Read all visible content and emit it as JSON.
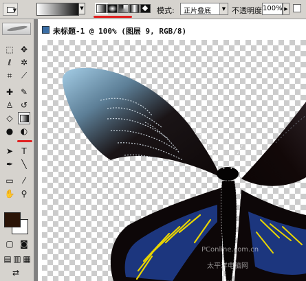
{
  "options_bar": {
    "mode_label": "模式:",
    "mode_value": "正片叠底",
    "opacity_label": "不透明度:",
    "opacity_value": "100%",
    "gradient_types": [
      "linear",
      "radial",
      "angle",
      "reflected",
      "diamond"
    ]
  },
  "document": {
    "title": "未标题-1 @ 100% (图层 9, RGB/8)"
  },
  "toolbox": {
    "active_tool": "gradient-tool",
    "foreground_color": "#2b1508",
    "background_color": "#ffffff"
  },
  "watermark": {
    "line1": "PConline.com.cn",
    "line2": "太平洋电脑网"
  },
  "colors": {
    "highlight": "#e02020",
    "wing_dark": "#120808",
    "wing_light": "#9cc6e0",
    "spot_blue": "#1e3c8c",
    "spot_yellow": "#e8d400"
  }
}
